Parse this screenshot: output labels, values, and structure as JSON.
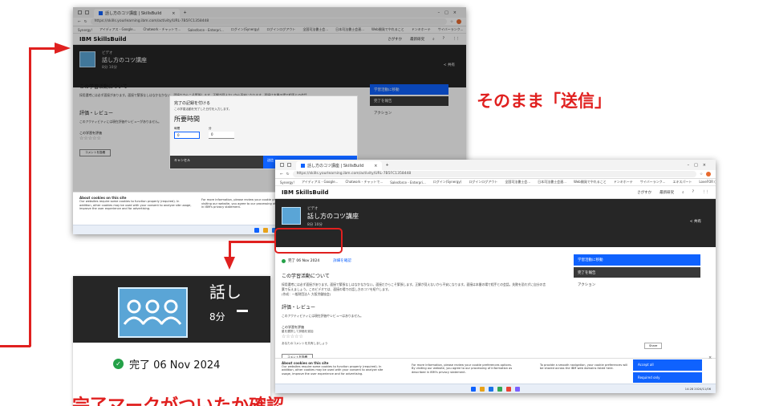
{
  "shot1": {
    "tab_title": "話し方のコツ講座 | SkillsBuild",
    "url": "https://skills.yourlearning.ibm.com/activity/URL-7B5FC1358448",
    "bookmarks": [
      "Synergy!",
      "アイディアス - Google...",
      "Chatwork - チャットで...",
      "Salesforce - Enterpri...",
      "ログイン(Synergy)",
      "ログインログアウト",
      "全国司法書士会...",
      "日本司法書士会連...",
      "Web開発でやれること",
      "ドンキホーテ",
      "サイバーランク...",
      "エキスパート",
      "LoveFOR (ラブフォー)"
    ],
    "brand": "IBM SkillsBuild",
    "nav_search": "さがすか",
    "nav_menu": "最新研究",
    "course_type": "ビデオ",
    "course_title": "話し方のコツ講座",
    "course_meta": "8分 10分",
    "share": "共有",
    "about_heading": "この学習活動について",
    "about_text": "採用選考には必ず面接があります。面接で緊張なしはなかなかない。面接だからこそ緊張します。正解が見えないから不安になります。面接は本番の場で相手との会話。",
    "review_heading": "評価・レビュー",
    "review_text": "このアクティビティには現在評価やレビューがありません。",
    "rate_heading": "この学習を評価",
    "stars": "☆☆☆☆☆",
    "comment_btn": "コメントを投稿",
    "panel": {
      "go": "学習活動に移動",
      "report": "完了を報告",
      "action": "アクション"
    },
    "modal": {
      "title": "完了の記録を付ける",
      "subtitle": "この学習活動を完了した日付を入力します。",
      "heading": "所要時間",
      "hours_label": "時間",
      "hours_value": "0",
      "minutes_label": "分",
      "minutes_value": "0",
      "cancel": "キャンセル",
      "submit": "送信"
    },
    "cookie_heading": "About cookies on this site",
    "cookie_text": "Our websites require some cookies to function properly (required). In addition, other cookies may be used with your consent to analyze site usage, improve the user experience and for advertising.",
    "cookie_more": "For more information, please review your cookie preferences options. By visiting our website, you agree to our processing of information as described in IBM's privacy statement."
  },
  "shot2": {
    "tab_title": "話し方のコツ講座 | SkillsBuild",
    "url": "https://skills.yourlearning.ibm.com/activity/URL-7B5FC1358448",
    "bookmarks": [
      "Synergy!",
      "アイディアス - Google...",
      "Chatwork - チャットで...",
      "Salesforce - Enterpri...",
      "ログイン(Synergy)",
      "ログインログアウト",
      "全国司法書士会...",
      "日本司法書士会連...",
      "Web開発でやれること",
      "ドンキホーテ",
      "サイバーランク...",
      "エキスパート",
      "LoveFOR (ラブフォー)"
    ],
    "brand": "IBM SkillsBuild",
    "nav_search": "さがすか",
    "nav_menu": "最新研究",
    "course_type": "ビデオ",
    "course_title": "話し方のコツ講座",
    "course_meta": "8分 10分",
    "share": "共有",
    "complete_status": "完了 06 Nov 2024",
    "complete_link": "詳細を確認",
    "about_heading": "この学習活動について",
    "about_text": "採用選考には必ず面接があります。面接で緊張なしはなかなかない。面接だからこそ緊張します。正解が見えないから不安になります。面接は本番の場で相手との会話。失敗を恐れずに自分の言葉で伝えましょう。このビデオでは、面接の場での話し方のコツを紹介します。",
    "about_credit": "(作成：一般財団法人 大阪労働協会)",
    "review_heading": "評価・レビュー",
    "review_text": "このアクティビティには現在評価やレビューはありません。",
    "rate_heading": "この学習を評価",
    "rate_sub": "星を選択して評価を追加",
    "stars": "☆☆☆☆☆",
    "comment_prompt": "あなたのコメントを共有しましょう",
    "comment_btn": "コメントを投稿",
    "share_btn": "Share",
    "panel": {
      "go": "学習活動に移動",
      "report": "完了を報告",
      "action": "アクション"
    },
    "cookie_heading": "About cookies on this site",
    "cookie_text": "Our websites require some cookies to function properly (required). In addition, other cookies may be used with your consent to analyze site usage, improve the user experience and for advertising.",
    "cookie_more": "For more information, please review your cookie preferences options. By visiting our website, you agree to our processing of information as described in IBM's privacy statement.",
    "cookie_pref": "To provide a smooth navigation, your cookie preferences will be shared across the IBM web domains listed here.",
    "accept_all": "Accept all",
    "required_only": "Required only",
    "clock": "14:28 2024/11/06"
  },
  "zoom": {
    "title_partial": "話し",
    "duration": "8分",
    "complete_status": "完了 06 Nov 2024"
  },
  "callouts": {
    "send_as_is": "そのまま「送信」",
    "bottom_partial": "完了マークがついたか確認"
  },
  "colors": {
    "annotation_red": "#e0201f",
    "ibm_blue": "#0f62fe",
    "success_green": "#24a148",
    "hero_dark": "#262626"
  }
}
